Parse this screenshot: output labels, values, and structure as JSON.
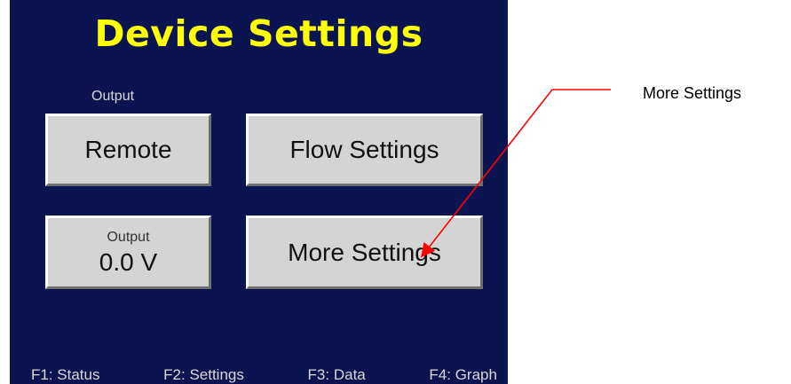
{
  "screen": {
    "title": "Device Settings",
    "output_label_top": "Output",
    "remote_button": "Remote",
    "flow_settings_button": "Flow Settings",
    "output_button": {
      "label": "Output",
      "value": "0.0 V"
    },
    "more_settings_button": "More Settings",
    "fkeys": [
      "F1: Status",
      "F2: Settings",
      "F3: Data",
      "F4: Graph"
    ]
  },
  "annotation": {
    "text": "More Settings",
    "color": "#ff0000"
  },
  "colors": {
    "screen_bg": "#0b1450",
    "title": "#ffff00",
    "button_face": "#d4d4d4"
  }
}
